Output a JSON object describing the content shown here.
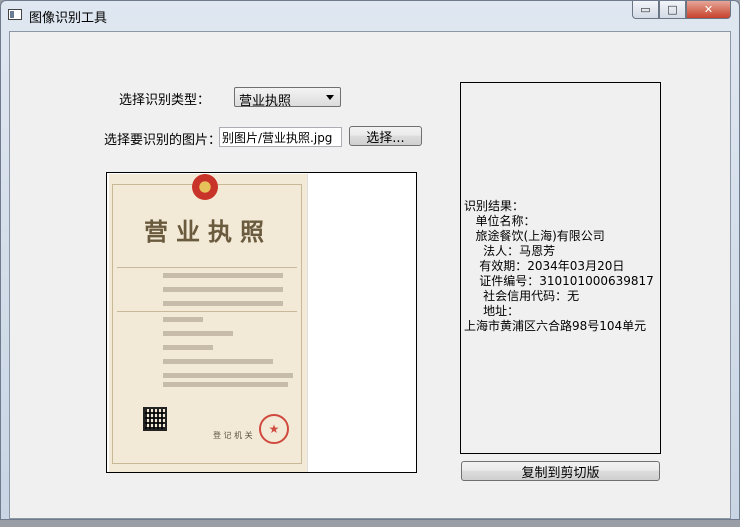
{
  "window": {
    "title": "图像识别工具"
  },
  "controls": {
    "minimize": "▭",
    "maximize": "□",
    "close": "✕"
  },
  "form": {
    "type_label": "选择识别类型：",
    "type_value": "营业执照",
    "image_label": "选择要识别的图片：",
    "image_path": "别图片/营业执照.jpg",
    "browse_button": "选择..."
  },
  "preview": {
    "title": "营业执照",
    "seal_char": "★",
    "registration_org": "登 记 机 关"
  },
  "result": {
    "lines": [
      "识别结果：",
      "   单位名称：",
      "   旅途餐饮(上海)有限公司",
      "     法人：马恩芳",
      "    有效期：2034年03月20日",
      "    证件编号：310101000639817",
      "     社会信用代码：无",
      "     地址：",
      "上海市黄浦区六合路98号104单元"
    ]
  },
  "copy_button": "复制到剪切版"
}
